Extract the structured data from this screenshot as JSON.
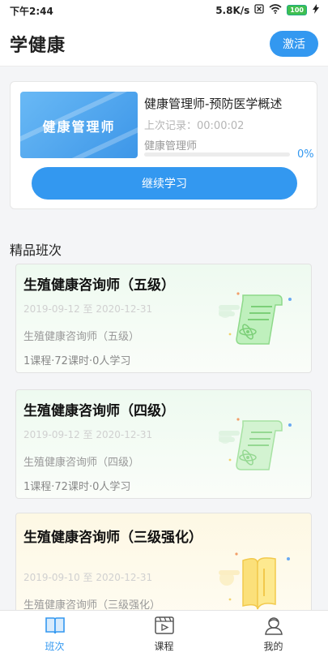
{
  "status_bar": {
    "time": "下午2:44",
    "speed": "5.8K/s",
    "battery": "100"
  },
  "header": {
    "title": "学健康",
    "activate_label": "激活"
  },
  "recent": {
    "cover_text": "健康管理师",
    "course_name": "健康管理师-预防医学概述",
    "last_record": "上次记录：00:00:02",
    "course_sub": "健康管理师",
    "progress": 0,
    "progress_label": "0%",
    "continue_label": "继续学习"
  },
  "section_title": "精品班次",
  "classes": [
    {
      "title": "生殖健康咨询师（五级）",
      "dates": "2019-09-12 至 2020-12-31",
      "subtitle": "生殖健康咨询师（五级）",
      "meta": "1课程·72课时·0人学习",
      "theme": "green"
    },
    {
      "title": "生殖健康咨询师（四级）",
      "dates": "2019-09-12 至 2020-12-31",
      "subtitle": "生殖健康咨询师（四级）",
      "meta": "1课程·72课时·0人学习",
      "theme": "green"
    },
    {
      "title": "生殖健康咨询师（三级强化）",
      "dates": "2019-09-10 至 2020-12-31",
      "subtitle": "生殖健康咨询师（三级强化）",
      "theme": "yellow"
    }
  ],
  "tabs": [
    {
      "label": "班次",
      "icon": "book-icon",
      "active": true
    },
    {
      "label": "课程",
      "icon": "video-icon",
      "active": false
    },
    {
      "label": "我的",
      "icon": "user-icon",
      "active": false
    }
  ],
  "colors": {
    "accent": "#3398f0",
    "card_green": "#eefaf0",
    "card_yellow": "#fdf8e4"
  }
}
